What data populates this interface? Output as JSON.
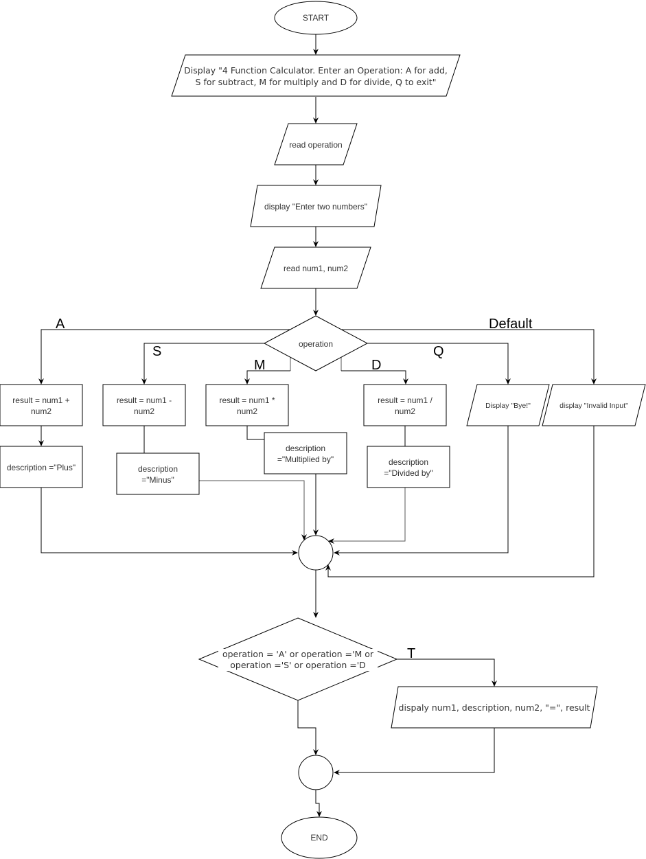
{
  "diagram": {
    "type": "flowchart",
    "nodes": {
      "start": {
        "label": "START"
      },
      "display_menu": {
        "lines": [
          "Display \"4 Function Calculator. Enter an Operation: A for add,",
          "S  for subtract, M for multiply and D for divide, Q to exit\""
        ]
      },
      "read_operation": {
        "label": "read operation"
      },
      "display_enter": {
        "label": "display \"Enter two numbers\""
      },
      "read_nums": {
        "label": "read num1, num2"
      },
      "switch_operation": {
        "label": "operation"
      },
      "add": {
        "lines": [
          "result = num1 +",
          "num2"
        ]
      },
      "sub": {
        "lines": [
          "result = num1 -",
          "num2"
        ]
      },
      "mul": {
        "lines": [
          "result = num1 *",
          "num2"
        ]
      },
      "div": {
        "lines": [
          "result = num1 /",
          "num2"
        ]
      },
      "desc_plus": {
        "label": "description =\"Plus\""
      },
      "desc_minus": {
        "lines": [
          "description",
          "=\"Minus\""
        ]
      },
      "desc_mult": {
        "lines": [
          "description",
          "=\"Multiplied by\""
        ]
      },
      "desc_div": {
        "lines": [
          "description",
          "=\"Divided by\""
        ]
      },
      "display_bye": {
        "label": "Display \"Bye!\""
      },
      "display_invalid": {
        "label": "display \"Invalid Input\""
      },
      "check_op": {
        "lines": [
          "operation = 'A' or  operation ='M or",
          "operation ='S' or operation ='D"
        ]
      },
      "display_result": {
        "label": "dispaly num1, description, num2, \"=\", result"
      },
      "end": {
        "label": "END"
      }
    },
    "edge_labels": {
      "a": "A",
      "s": "S",
      "m": "M",
      "d": "D",
      "q": "Q",
      "default": "Default",
      "t": "T"
    },
    "edges": [
      [
        "start",
        "display_menu"
      ],
      [
        "display_menu",
        "read_operation"
      ],
      [
        "read_operation",
        "display_enter"
      ],
      [
        "display_enter",
        "read_nums"
      ],
      [
        "read_nums",
        "switch_operation"
      ],
      [
        "switch_operation",
        "add",
        "A"
      ],
      [
        "switch_operation",
        "sub",
        "S"
      ],
      [
        "switch_operation",
        "mul",
        "M"
      ],
      [
        "switch_operation",
        "div",
        "D"
      ],
      [
        "switch_operation",
        "display_bye",
        "Q"
      ],
      [
        "switch_operation",
        "display_invalid",
        "Default"
      ],
      [
        "add",
        "desc_plus"
      ],
      [
        "sub",
        "desc_minus"
      ],
      [
        "mul",
        "desc_mult"
      ],
      [
        "div",
        "desc_div"
      ],
      [
        "desc_plus",
        "merge1"
      ],
      [
        "desc_minus",
        "merge1"
      ],
      [
        "desc_mult",
        "merge1"
      ],
      [
        "desc_div",
        "merge1"
      ],
      [
        "display_bye",
        "merge1"
      ],
      [
        "display_invalid",
        "merge1"
      ],
      [
        "merge1",
        "check_op"
      ],
      [
        "check_op",
        "display_result",
        "T"
      ],
      [
        "check_op",
        "merge2"
      ],
      [
        "display_result",
        "merge2"
      ],
      [
        "merge2",
        "end"
      ]
    ]
  }
}
